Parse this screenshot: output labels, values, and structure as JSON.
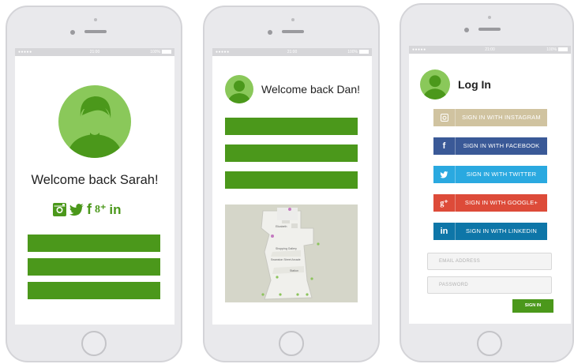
{
  "status_bar": {
    "signal": "●●●●●",
    "time": "21:00",
    "battery": "100%"
  },
  "screen1": {
    "welcome": "Welcome back Sarah!"
  },
  "screen2": {
    "welcome": "Welcome back Dan!",
    "map_labels": [
      "Shopping Gallery",
      "Swanston Street Arcade",
      "Station",
      "Elizabeth"
    ]
  },
  "screen3": {
    "title": "Log In",
    "buttons": [
      {
        "label": "SIGN IN WITH INSTAGRAM",
        "icon": "instagram-icon",
        "color": "#d0c3a0"
      },
      {
        "label": "SIGN IN WITH FACEBOOK",
        "icon": "facebook-icon",
        "color": "#3a5997"
      },
      {
        "label": "SIGN IN WITH TWITTER",
        "icon": "twitter-icon",
        "color": "#2aa9e0"
      },
      {
        "label": "SIGN IN WITH GOOGLE+",
        "icon": "google-plus-icon",
        "color": "#dd4b39"
      },
      {
        "label": "SIGN IN WITH LINKEDIN",
        "icon": "linkedin-icon",
        "color": "#0e76a8"
      }
    ],
    "email_placeholder": "EMAIL ADDRESS",
    "password_placeholder": "PASSWORD",
    "signin": "SIGN IN"
  },
  "colors": {
    "brand_green": "#4b981b",
    "avatar_light": "#8ac85a",
    "frame": "#e9e9ec"
  }
}
